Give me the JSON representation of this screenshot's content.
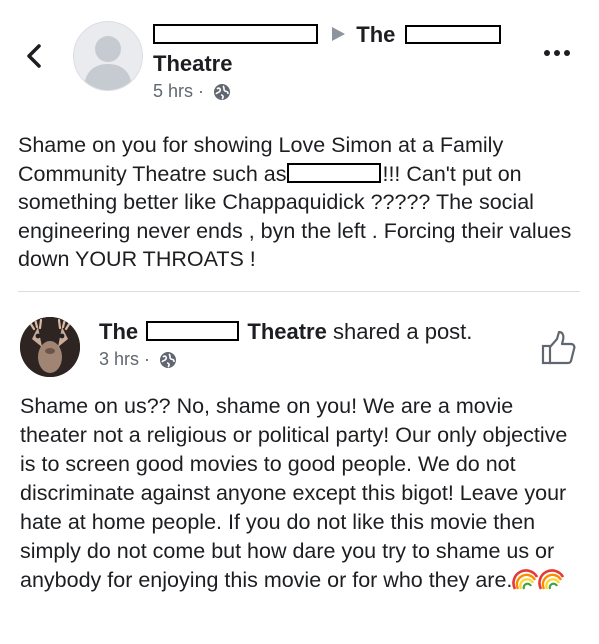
{
  "header": {
    "back_icon": "chevron-left-icon",
    "more_icon": "more-dots-icon"
  },
  "post1": {
    "author_prefix": "",
    "separator_icon": "triangle-right-icon",
    "page_name_part1": "The",
    "page_name_part2": "Theatre",
    "time": "5 hrs",
    "dot": "·",
    "privacy_icon": "globe-icon",
    "text_part1": "Shame on you for showing Love Simon at a  Family Community Theatre  such as",
    "text_part2": "!!! Can't put on something better like Chappaquidick ?????   The social engineering never ends , byn the left . Forcing their values down YOUR THROATS !"
  },
  "post2": {
    "page_name_part1": "The",
    "page_name_part2": "Theatre",
    "action": "shared a post.",
    "time": "3 hrs",
    "dot": "·",
    "privacy_icon": "globe-icon",
    "like_icon": "thumbs-up-icon",
    "text": "Shame on us?? No, shame on you! We are a movie theater not a religious or political party! Our only objective is to screen good movies to good people. We do not discriminate against anyone except this bigot! Leave your hate at home people. If you do not like this movie then simply do not come but how dare you try to shame us or anybody for enjoying this movie or for who they are.",
    "emoji": "rainbow-emoji"
  }
}
